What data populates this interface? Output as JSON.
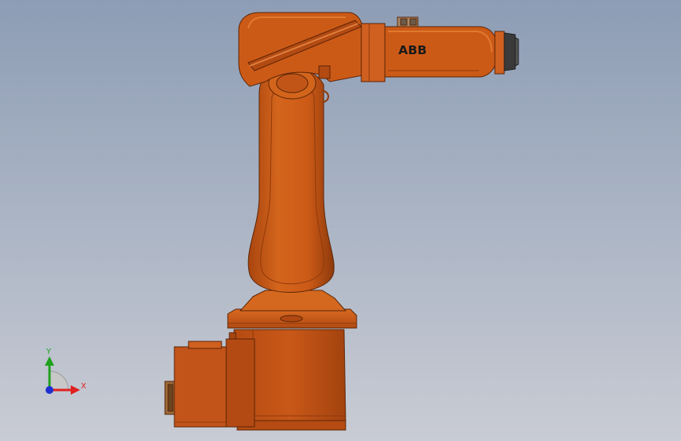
{
  "viewport": {
    "background_top": "#8d9db5",
    "background_bottom": "#c9ccd4"
  },
  "model": {
    "brand_logo": "ABB",
    "body_color": "#cc5a17",
    "highlight_color": "#e07a2e",
    "shadow_color": "#8e3a0c",
    "outline_color": "#5a2406",
    "flange_color": "#3a3a3a"
  },
  "triad": {
    "x_label": "X",
    "y_label": "Y",
    "x_color": "#e02020",
    "y_color": "#1fa11f",
    "z_color": "#2030d0"
  }
}
